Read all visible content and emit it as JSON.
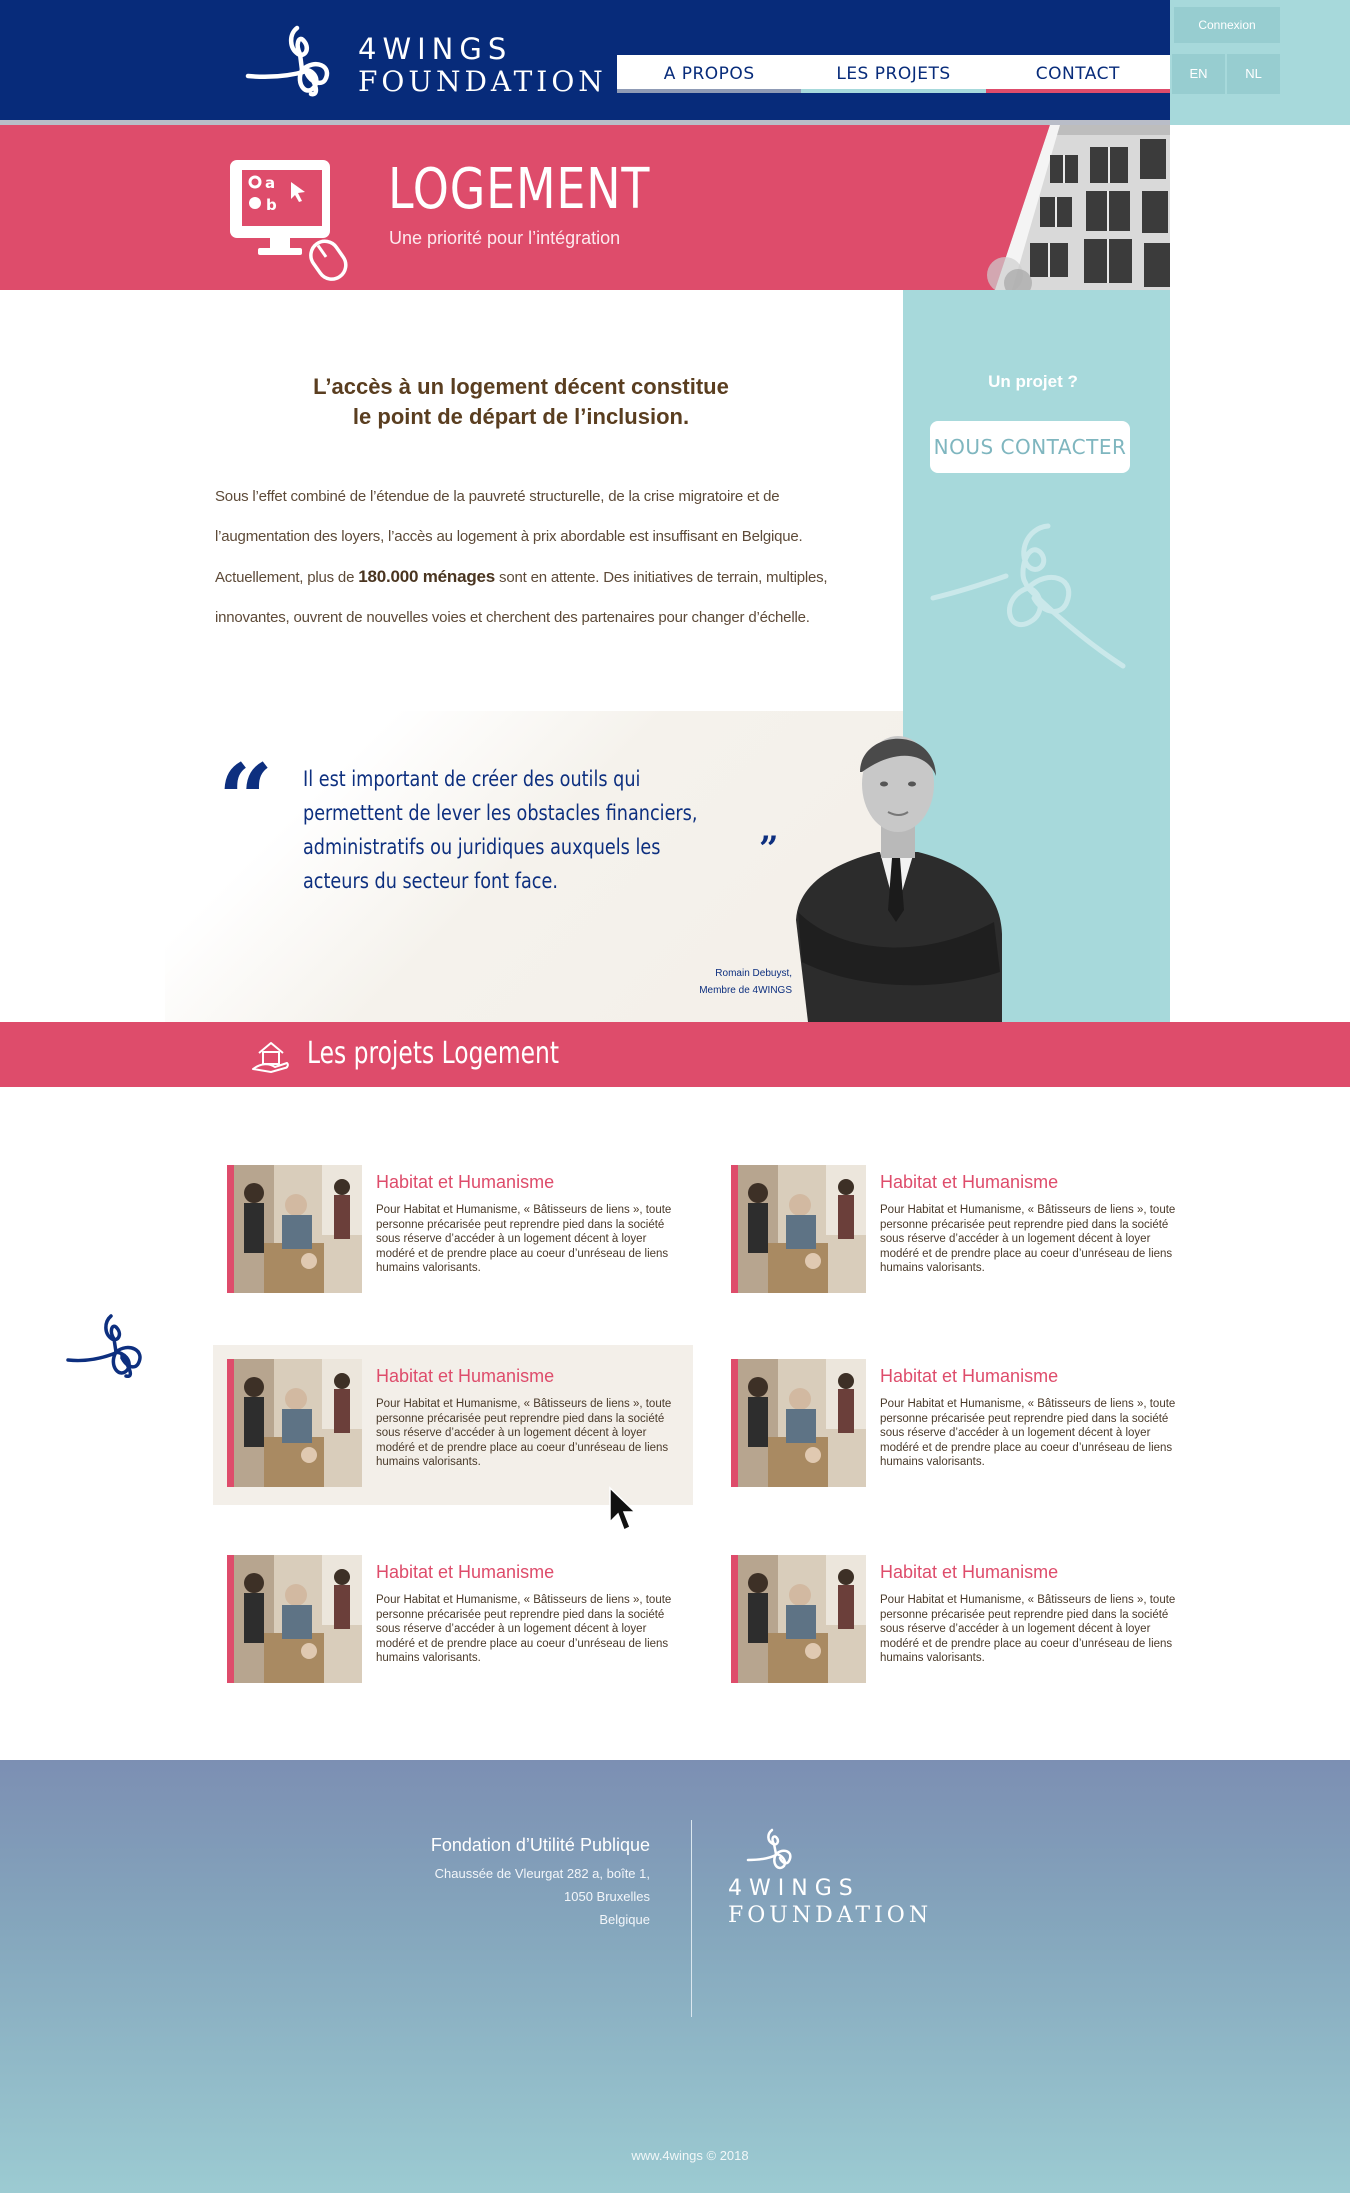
{
  "brand": {
    "word1": "4WINGS",
    "word2": "FOUNDATION"
  },
  "nav": {
    "items": [
      {
        "label": "A PROPOS",
        "color": "#8f9bb5"
      },
      {
        "label": "LES PROJETS",
        "color": "#a7d9db"
      },
      {
        "label": "CONTACT",
        "color": "#de4c6b"
      }
    ],
    "login_label": "Connexion",
    "languages": [
      "EN",
      "NL"
    ]
  },
  "hero": {
    "title": "LOGEMENT",
    "subtitle": "Une priorité pour l’intégration",
    "icon": "computer-mouse-icon"
  },
  "aside": {
    "question": "Un projet  ?",
    "button_label": "NOUS CONTACTER"
  },
  "intro": {
    "heading_line1": "L’accès à un logement décent constitue",
    "heading_line2": "le point de départ de l’inclusion.",
    "text_before": "Sous l’effet combiné de l’étendue de la pauvreté structurelle, de la crise migratoire et de l’augmentation des loyers, l’accès au logement à prix abordable est insuffisant en Belgique. Actuellement, plus de ",
    "highlight": "180.000 ménages",
    "text_after": " sont en attente. Des initiatives de terrain, multiples, innovantes, ouvrent de nouvelles voies et cherchent des partenaires pour changer d’échelle."
  },
  "quote": {
    "open_mark": "“",
    "text": "Il est important de créer des outils qui permettent de lever les obstacles financiers, administratifs ou juridiques auxquels les acteurs du secteur font face.",
    "close_mark": "”",
    "author": "Romain Debuyst,",
    "author_role": "Membre de 4WINGS"
  },
  "projects_section": {
    "title": "Les projets Logement",
    "icon": "house-hand-icon"
  },
  "projects": [
    {
      "title": "Habitat et Humanisme",
      "text": "Pour Habitat et Humanisme, « Bâtisseurs de liens », toute personne précarisée peut reprendre pied dans la société sous réserve d’accéder à un logement décent à loyer modéré et de prendre place au coeur d’unréseau de liens humains valorisants."
    },
    {
      "title": "Habitat et Humanisme",
      "text": "Pour Habitat et Humanisme, « Bâtisseurs de liens », toute personne précarisée peut reprendre pied dans la société sous réserve d’accéder à un logement décent à loyer modéré et de prendre place au coeur d’unréseau de liens humains valorisants."
    },
    {
      "title": "Habitat et Humanisme",
      "text": "Pour Habitat et Humanisme, « Bâtisseurs de liens », toute personne précarisée peut reprendre pied dans la société sous réserve d’accéder à un logement décent à loyer modéré et de prendre place au coeur d’unréseau de liens humains valorisants."
    },
    {
      "title": "Habitat et Humanisme",
      "text": "Pour Habitat et Humanisme, « Bâtisseurs de liens », toute personne précarisée peut reprendre pied dans la société sous réserve d’accéder à un logement décent à loyer modéré et de prendre place au coeur d’unréseau de liens humains valorisants."
    },
    {
      "title": "Habitat et Humanisme",
      "text": "Pour Habitat et Humanisme, « Bâtisseurs de liens », toute personne précarisée peut reprendre pied dans la société sous réserve d’accéder à un logement décent à loyer modéré et de prendre place au coeur d’unréseau de liens humains valorisants."
    },
    {
      "title": "Habitat et Humanisme",
      "text": "Pour Habitat et Humanisme, « Bâtisseurs de liens », toute personne précarisée peut reprendre pied dans la société sous réserve d’accéder à un logement décent à loyer modéré et de prendre place au coeur d’unréseau de liens humains valorisants."
    }
  ],
  "footer": {
    "heading": "Fondation d’Utilité Publique",
    "address1": "Chaussée de Vleurgat 282 a, boîte 1,",
    "address2": "1050 Bruxelles",
    "address3": "Belgique",
    "copyright": "www.4wings © 2018"
  },
  "colors": {
    "navy": "#072b7a",
    "pink": "#de4c6b",
    "aqua": "#a7d9db"
  }
}
